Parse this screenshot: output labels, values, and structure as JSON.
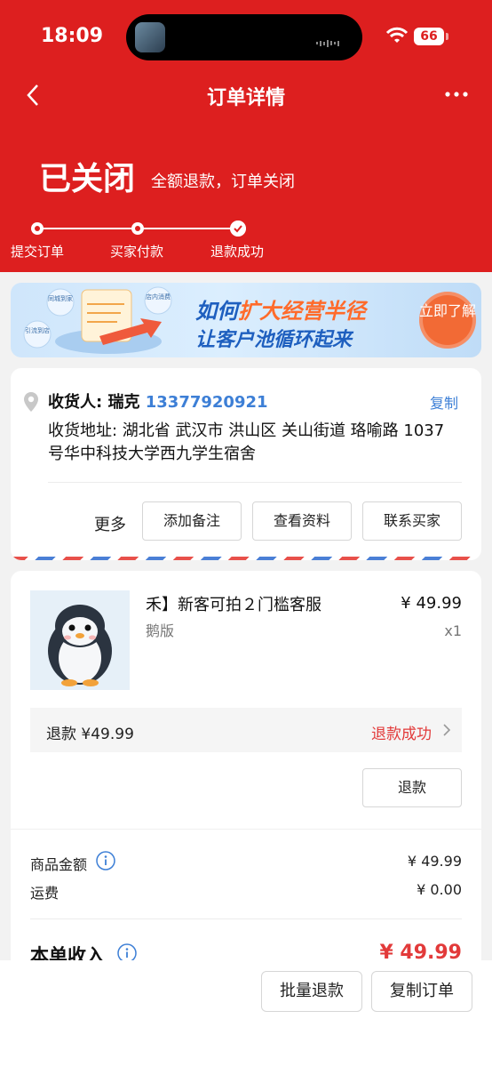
{
  "status_bar": {
    "time": "18:09",
    "battery": "66"
  },
  "nav": {
    "title": "订单详情"
  },
  "order_status": {
    "title": "已关闭",
    "subtitle": "全额退款，订单关闭"
  },
  "steps": [
    {
      "label": "提交订单"
    },
    {
      "label": "买家付款"
    },
    {
      "label": "退款成功"
    }
  ],
  "banner": {
    "line1_prefix": "如何",
    "line1_highlight": "扩大经营半径",
    "line2": "让客户池循环起来",
    "button": "立即了解",
    "tag1": "同城到家",
    "tag2": "店内消费",
    "tag3": "引流到店"
  },
  "address": {
    "receiver_label": "收货人: 瑞克",
    "phone": "13377920921",
    "copy": "复制",
    "text": "收货地址: 湖北省 武汉市 洪山区 关山街道 珞喻路 1037号华中科技大学西九学生宿舍",
    "more": "更多",
    "actions": [
      "添加备注",
      "查看资料",
      "联系买家"
    ]
  },
  "goods": {
    "title": "禾】新客可拍２门槛客服",
    "spec": "鹅版",
    "price": "¥ 49.99",
    "qty": "x1",
    "refund_text": "退款 ¥49.99",
    "refund_status": "退款成功",
    "refund_button": "退款"
  },
  "amounts": {
    "goods_label": "商品金额",
    "goods_value": "¥ 49.99",
    "shipping_label": "运费",
    "shipping_value": "¥ 0.00",
    "income_label": "本单收入",
    "income_value": "¥ 49.99"
  },
  "bottom": {
    "batch_refund": "批量退款",
    "copy_order": "复制订单"
  },
  "colors": {
    "primary_red": "#dd1f1f",
    "link_blue": "#3d7fd6",
    "alert_red": "#e23a3a"
  }
}
